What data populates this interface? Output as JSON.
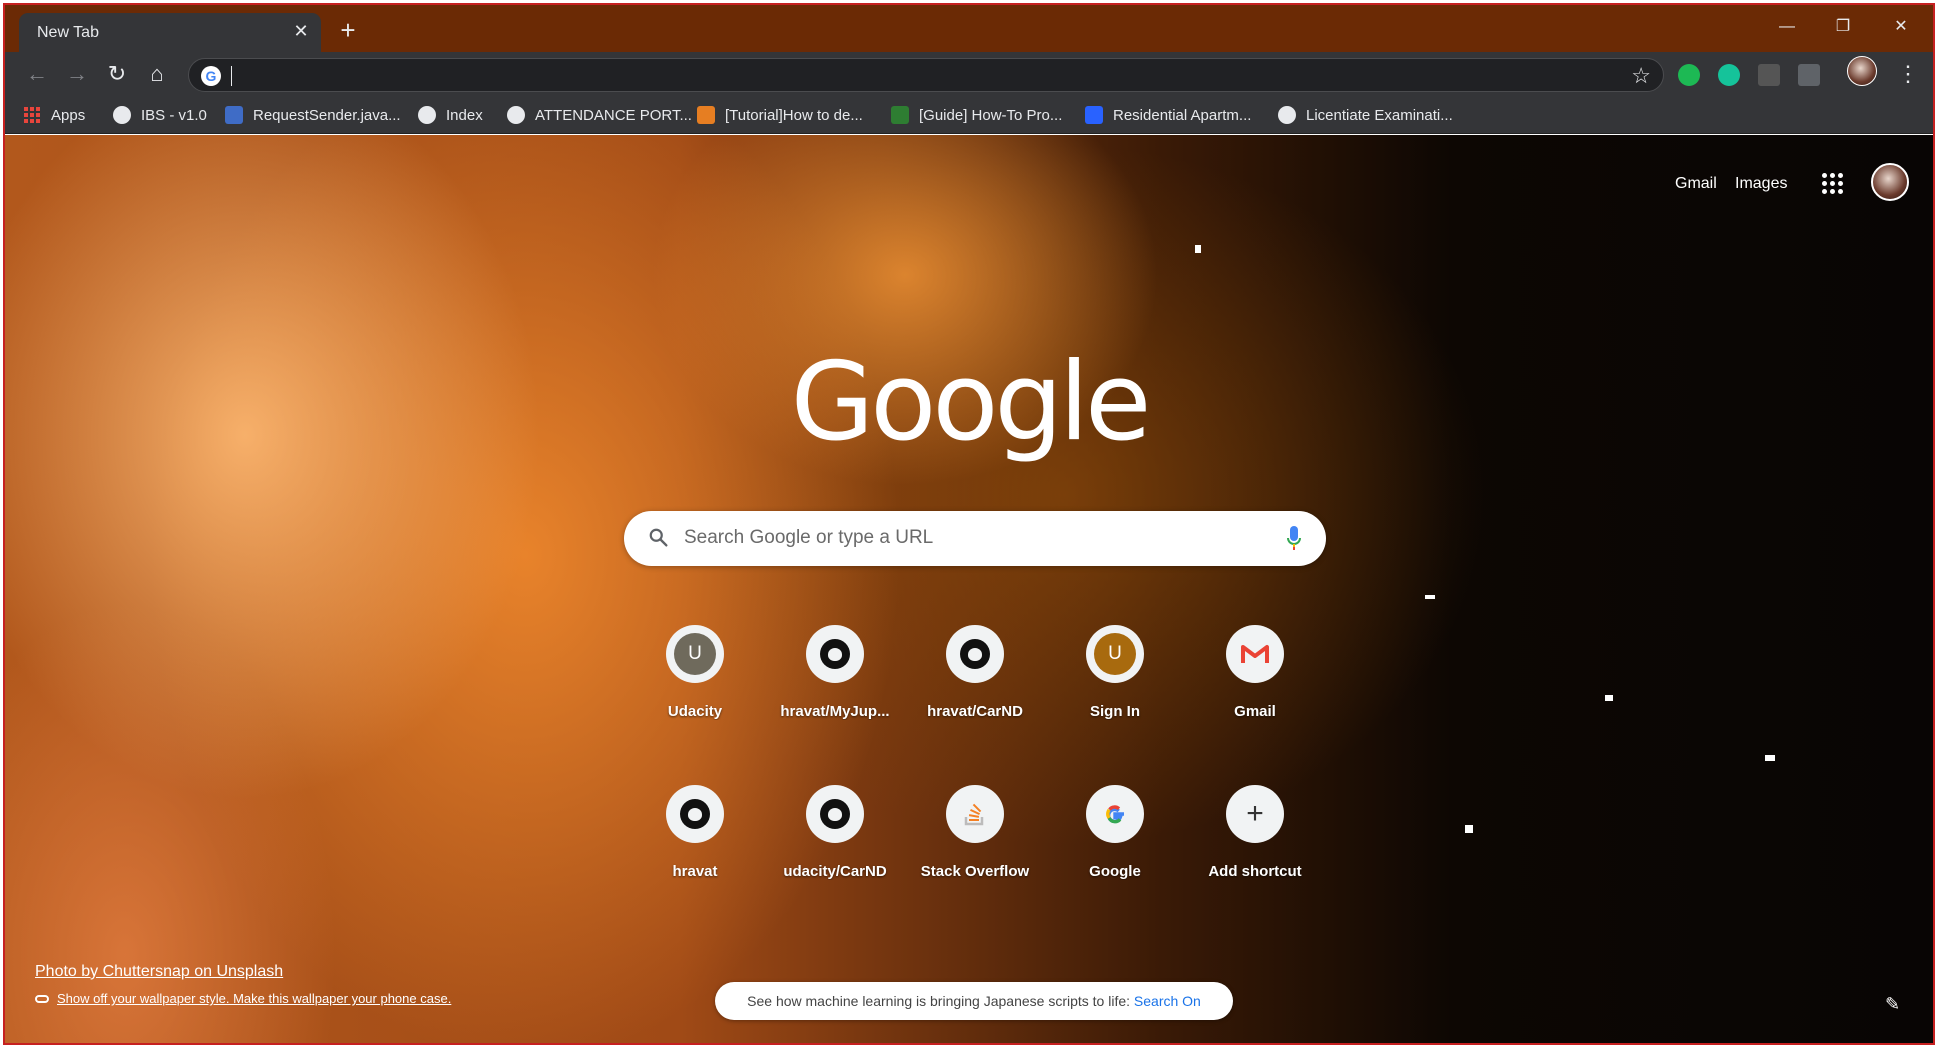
{
  "tab": {
    "title": "New Tab",
    "close": "✕",
    "new_tab": "+"
  },
  "window": {
    "minimize": "—",
    "restore": "❐",
    "close": "✕"
  },
  "toolbar": {
    "back": "←",
    "forward": "→",
    "reload": "↻",
    "home": "⌂",
    "omnibox": {
      "value": "",
      "placeholder": ""
    },
    "star": "☆",
    "menu": "⋮",
    "extensions": [
      {
        "name": "green-d-extension",
        "color": "#1db954"
      },
      {
        "name": "grammarly-extension",
        "color": "#15c39a"
      },
      {
        "name": "m-extension",
        "color": "#555555"
      },
      {
        "name": "ui-extension",
        "color": "#5f6368"
      }
    ]
  },
  "bookmarks": [
    {
      "label": "Apps",
      "icon": "apps-grid-icon"
    },
    {
      "label": "IBS - v1.0",
      "icon": "globe-icon"
    },
    {
      "label": "RequestSender.java...",
      "icon": "java-icon"
    },
    {
      "label": "Index",
      "icon": "globe-icon"
    },
    {
      "label": "ATTENDANCE PORT...",
      "icon": "globe-icon"
    },
    {
      "label": "[Tutorial]How to de...",
      "icon": "xda-icon"
    },
    {
      "label": "[Guide] How-To Pro...",
      "icon": "guide-icon"
    },
    {
      "label": "Residential Apartm...",
      "icon": "99acres-icon"
    },
    {
      "label": "Licentiate Examinati...",
      "icon": "globe-icon"
    }
  ],
  "header_links": {
    "gmail": "Gmail",
    "images": "Images"
  },
  "logo": "Google",
  "search": {
    "placeholder": "Search Google or type a URL"
  },
  "shortcuts": [
    {
      "label": "Udacity",
      "icon": "letter",
      "letter": "U",
      "color": "#6f6a5c"
    },
    {
      "label": "hravat/MyJup...",
      "icon": "github-icon"
    },
    {
      "label": "hravat/CarND",
      "icon": "github-icon"
    },
    {
      "label": "Sign In",
      "icon": "letter",
      "letter": "U",
      "color": "#a86a0e"
    },
    {
      "label": "Gmail",
      "icon": "gmail-icon"
    },
    {
      "label": "hravat",
      "icon": "github-icon"
    },
    {
      "label": "udacity/CarND",
      "icon": "github-icon"
    },
    {
      "label": "Stack Overflow",
      "icon": "stackoverflow-icon"
    },
    {
      "label": "Google",
      "icon": "google-icon"
    },
    {
      "label": "Add shortcut",
      "icon": "plus-icon",
      "glyph": "+"
    }
  ],
  "footer": {
    "photo_credit": "Photo by Chuttersnap on Unsplash",
    "wallpaper_link": "Show off your wallpaper style. Make this wallpaper your phone case.",
    "promo_text": "See how machine learning is bringing Japanese scripts to life: ",
    "promo_link": "Search On"
  }
}
